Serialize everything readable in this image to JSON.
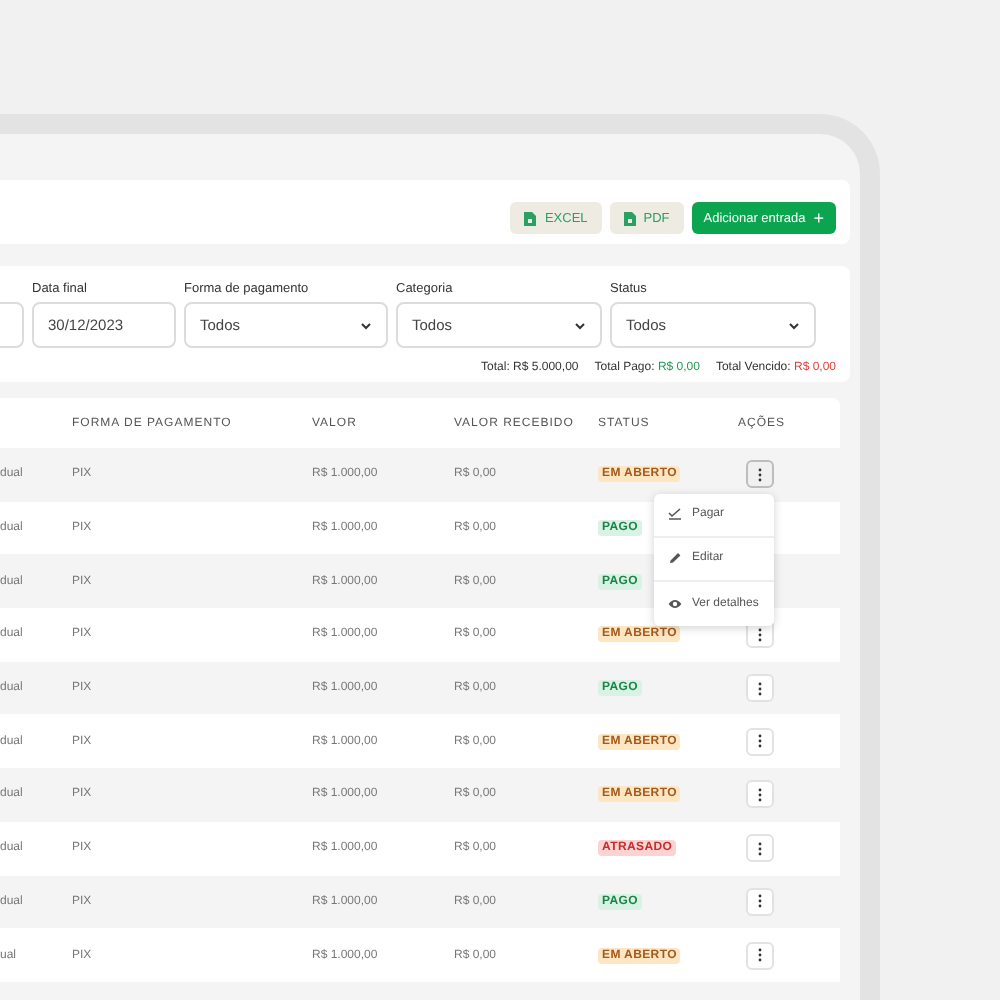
{
  "toolbar": {
    "buttons": [
      {
        "label": "EXCEL",
        "kind": "export"
      },
      {
        "label": "PDF",
        "kind": "export"
      },
      {
        "label": "Adicionar entrada",
        "kind": "primary",
        "icon": "+"
      }
    ]
  },
  "filters": {
    "fields": [
      {
        "kind": "date"
      },
      {
        "kind": "date",
        "label": "Data final",
        "value": "30/12/2023"
      },
      {
        "kind": "select",
        "label": "Forma de pagamento",
        "value": "Todos"
      },
      {
        "kind": "select",
        "label": "Categoria",
        "value": "Todos"
      },
      {
        "kind": "select",
        "label": "Status",
        "value": "Todos"
      }
    ],
    "totals": [
      {
        "label": "Total:",
        "value": "R$ 5.000,00",
        "color": "#333333"
      },
      {
        "label": "Total Pago:",
        "value": "R$ 0,00",
        "color": "#1e9a55"
      },
      {
        "label": "Total Vencido:",
        "value": "R$ 0,00",
        "color": "#e03b3b"
      }
    ]
  },
  "table": {
    "columns": [
      "FORMA DE PAGAMENTO",
      "VALOR",
      "VALOR RECEBIDO",
      "STATUS",
      "AÇÕES"
    ],
    "rows": [
      {
        "column_1": "dual",
        "payment": "PIX",
        "value": "R$ 1.000,00",
        "received": "R$ 0,00",
        "status": "EM ABERTO",
        "kind": "open",
        "menu_open": true
      },
      {
        "column_1": "dual",
        "payment": "PIX",
        "value": "R$ 1.000,00",
        "received": "R$ 0,00",
        "status": "PAGO",
        "kind": "paid",
        "menu_open": false
      },
      {
        "column_1": "dual",
        "payment": "PIX",
        "value": "R$ 1.000,00",
        "received": "R$ 0,00",
        "status": "PAGO",
        "kind": "paid",
        "menu_open": false
      },
      {
        "column_1": "dual",
        "payment": "PIX",
        "value": "R$ 1.000,00",
        "received": "R$ 0,00",
        "status": "EM ABERTO",
        "kind": "open",
        "menu_open": false
      },
      {
        "column_1": "dual",
        "payment": "PIX",
        "value": "R$ 1.000,00",
        "received": "R$ 0,00",
        "status": "PAGO",
        "kind": "paid",
        "menu_open": false
      },
      {
        "column_1": "dual",
        "payment": "PIX",
        "value": "R$ 1.000,00",
        "received": "R$ 0,00",
        "status": "EM ABERTO",
        "kind": "open",
        "menu_open": false
      },
      {
        "column_1": "dual",
        "payment": "PIX",
        "value": "R$ 1.000,00",
        "received": "R$ 0,00",
        "status": "EM ABERTO",
        "kind": "open",
        "menu_open": false
      },
      {
        "column_1": "dual",
        "payment": "PIX",
        "value": "R$ 1.000,00",
        "received": "R$ 0,00",
        "status": "ATRASADO",
        "kind": "overdue",
        "menu_open": false
      },
      {
        "column_1": "dual",
        "payment": "PIX",
        "value": "R$ 1.000,00",
        "received": "R$ 0,00",
        "status": "PAGO",
        "kind": "paid",
        "menu_open": false
      },
      {
        "column_1": "ual",
        "payment": "PIX",
        "value": "R$ 1.000,00",
        "received": "R$ 0,00",
        "status": "EM ABERTO",
        "kind": "open",
        "menu_open": false
      }
    ],
    "menu": [
      {
        "label": "Pagar"
      },
      {
        "label": "Editar"
      },
      {
        "label": "Ver detalhes"
      }
    ]
  }
}
